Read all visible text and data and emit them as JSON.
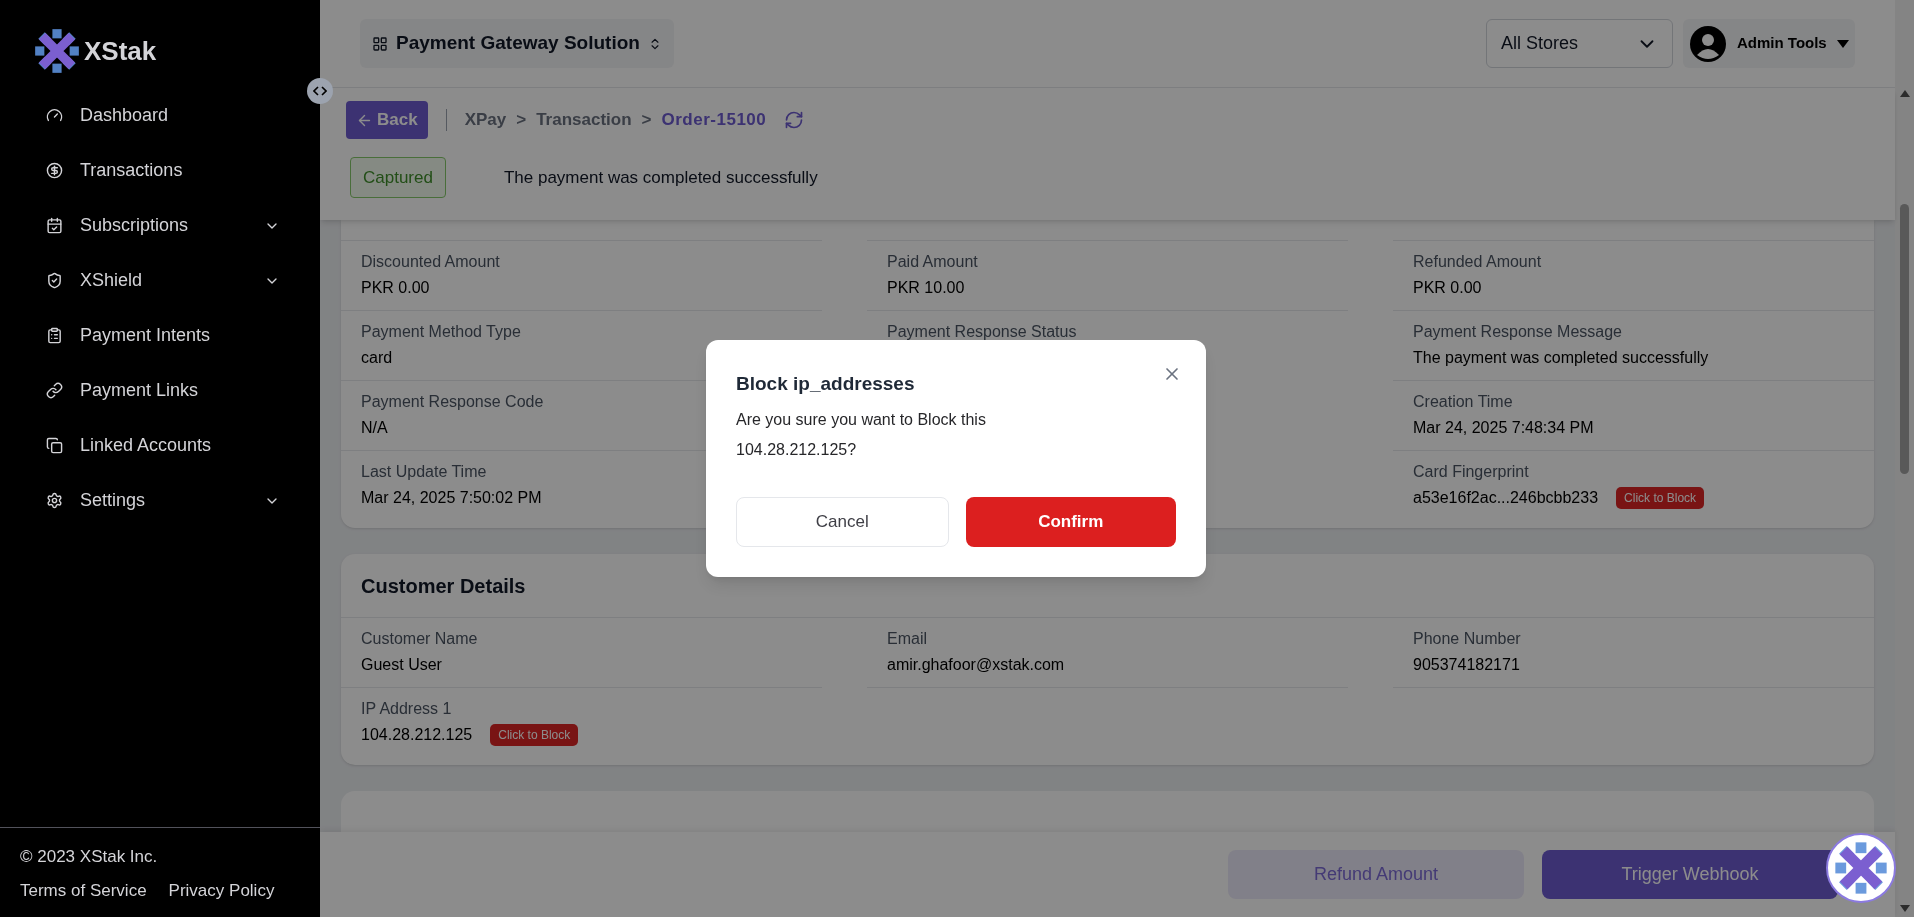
{
  "sidebar": {
    "logo": "XStak",
    "items": [
      {
        "label": "Dashboard",
        "expandable": false
      },
      {
        "label": "Transactions",
        "expandable": false
      },
      {
        "label": "Subscriptions",
        "expandable": true
      },
      {
        "label": "XShield",
        "expandable": true
      },
      {
        "label": "Payment Intents",
        "expandable": false
      },
      {
        "label": "Payment Links",
        "expandable": false
      },
      {
        "label": "Linked Accounts",
        "expandable": false
      },
      {
        "label": "Settings",
        "expandable": true
      }
    ],
    "copyright": "© 2023 XStak Inc.",
    "footer_links": [
      "Terms of Service",
      "Privacy Policy"
    ]
  },
  "header": {
    "product": "Payment Gateway Solution",
    "store_select": "All Stores",
    "user": "Admin Tools"
  },
  "breadcrumb": {
    "back": "Back",
    "path": [
      {
        "label": "XPay",
        "current": false
      },
      {
        "label": ">",
        "current": false
      },
      {
        "label": "Transaction",
        "current": false
      },
      {
        "label": ">",
        "current": false
      },
      {
        "label": "Order-15100",
        "current": true
      }
    ]
  },
  "status": {
    "badge": "Captured",
    "message": "The payment was completed successfully"
  },
  "payment_details": {
    "rows": [
      [
        {
          "label": "Discounted Amount",
          "value": "PKR 0.00"
        },
        {
          "label": "Paid Amount",
          "value": "PKR 10.00"
        },
        {
          "label": "Refunded Amount",
          "value": "PKR 0.00"
        }
      ],
      [
        {
          "label": "Payment Method Type",
          "value": "card"
        },
        {
          "label": "Payment Response Status"
        },
        {
          "label": "Payment Response Message",
          "value": "The payment was completed successfully"
        }
      ],
      [
        {
          "label": "Payment Response Code",
          "value": "N/A"
        },
        null,
        {
          "label": "Creation Time",
          "value": "Mar 24, 2025 7:48:34 PM"
        }
      ],
      [
        {
          "label": "Last Update Time",
          "value": "Mar 24, 2025 7:50:02 PM"
        },
        null,
        {
          "label": "Card Fingerprint",
          "value": "a53e16f2ac...246bcbb233",
          "action": "Click to Block"
        }
      ]
    ]
  },
  "customer_details": {
    "title": "Customer Details",
    "rows": [
      [
        {
          "label": "Customer Name",
          "value": "Guest User"
        },
        {
          "label": "Email",
          "value": "amir.ghafoor@xstak.com"
        },
        {
          "label": "Phone Number",
          "value": "905374182171"
        }
      ],
      [
        {
          "label": "IP Address 1",
          "value": "104.28.212.125",
          "action": "Click to Block"
        },
        null,
        null
      ]
    ]
  },
  "actions": [
    {
      "label": "Refund Amount",
      "disabled": true
    },
    {
      "label": "Trigger Webhook",
      "disabled": false
    }
  ],
  "dialog": {
    "title": "Block ip_addresses",
    "message": "Are you sure you want to Block this 104.28.212.125?",
    "buttons": [
      {
        "label": "Cancel",
        "kind": "secondary"
      },
      {
        "label": "Confirm",
        "kind": "danger"
      }
    ]
  }
}
